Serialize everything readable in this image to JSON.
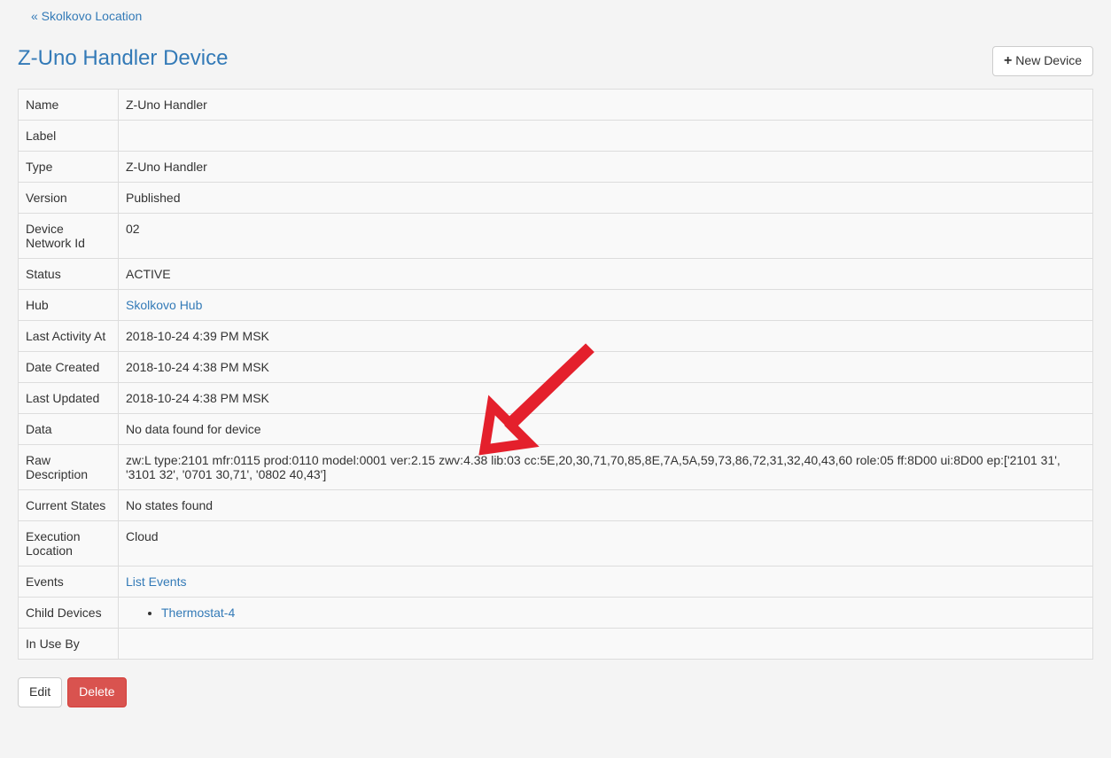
{
  "breadcrumb": {
    "back_label": "« Skolkovo Location"
  },
  "header": {
    "title": "Z-Uno Handler Device",
    "new_device_label": "New Device"
  },
  "table": {
    "rows": [
      {
        "label": "Name",
        "value": "Z-Uno Handler",
        "type": "text"
      },
      {
        "label": "Label",
        "value": "",
        "type": "text"
      },
      {
        "label": "Type",
        "value": "Z-Uno Handler",
        "type": "text"
      },
      {
        "label": "Version",
        "value": "Published",
        "type": "text"
      },
      {
        "label": "Device Network Id",
        "value": "02",
        "type": "text"
      },
      {
        "label": "Status",
        "value": "ACTIVE",
        "type": "text"
      },
      {
        "label": "Hub",
        "value": "Skolkovo Hub",
        "type": "link"
      },
      {
        "label": "Last Activity At",
        "value": "2018-10-24 4:39 PM MSK",
        "type": "text"
      },
      {
        "label": "Date Created",
        "value": "2018-10-24 4:38 PM MSK",
        "type": "text"
      },
      {
        "label": "Last Updated",
        "value": "2018-10-24 4:38 PM MSK",
        "type": "text"
      },
      {
        "label": "Data",
        "value": "No data found for device",
        "type": "text"
      },
      {
        "label": "Raw Description",
        "value": "zw:L type:2101 mfr:0115 prod:0110 model:0001 ver:2.15 zwv:4.38 lib:03 cc:5E,20,30,71,70,85,8E,7A,5A,59,73,86,72,31,32,40,43,60 role:05 ff:8D00 ui:8D00 ep:['2101 31', '3101 32', '0701 30,71', '0802 40,43']",
        "type": "text"
      },
      {
        "label": "Current States",
        "value": "No states found",
        "type": "text"
      },
      {
        "label": "Execution Location",
        "value": "Cloud",
        "type": "text"
      },
      {
        "label": "Events",
        "value": "List Events",
        "type": "link"
      },
      {
        "label": "Child Devices",
        "value": "Thermostat-4",
        "type": "childlist"
      },
      {
        "label": "In Use By",
        "value": "",
        "type": "text"
      }
    ]
  },
  "buttons": {
    "edit_label": "Edit",
    "delete_label": "Delete"
  }
}
